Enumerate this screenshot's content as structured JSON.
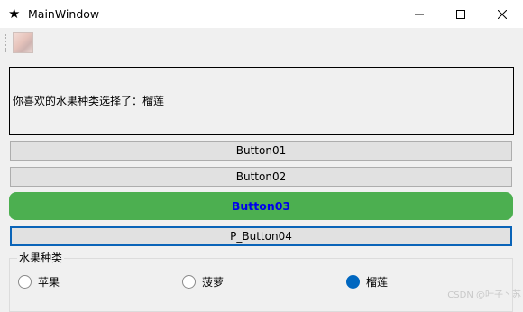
{
  "window": {
    "title": "MainWindow",
    "icon": "star-icon"
  },
  "toolbar": {
    "items": [
      {
        "icon": "avatar-image-icon"
      }
    ]
  },
  "main": {
    "label_text": "你喜欢的水果种类选择了：榴莲",
    "buttons": [
      {
        "label": "Button01"
      },
      {
        "label": "Button02"
      },
      {
        "label": "Button03",
        "bg_color": "#4caf50",
        "text_color": "#0000ee"
      },
      {
        "label": "P_Button04",
        "border_color": "#0a64b8"
      }
    ],
    "group": {
      "title": "水果种类",
      "options": [
        {
          "label": "苹果",
          "checked": false
        },
        {
          "label": "菠萝",
          "checked": false
        },
        {
          "label": "榴莲",
          "checked": true
        }
      ]
    }
  },
  "watermark": "CSDN @叶子丶苏"
}
